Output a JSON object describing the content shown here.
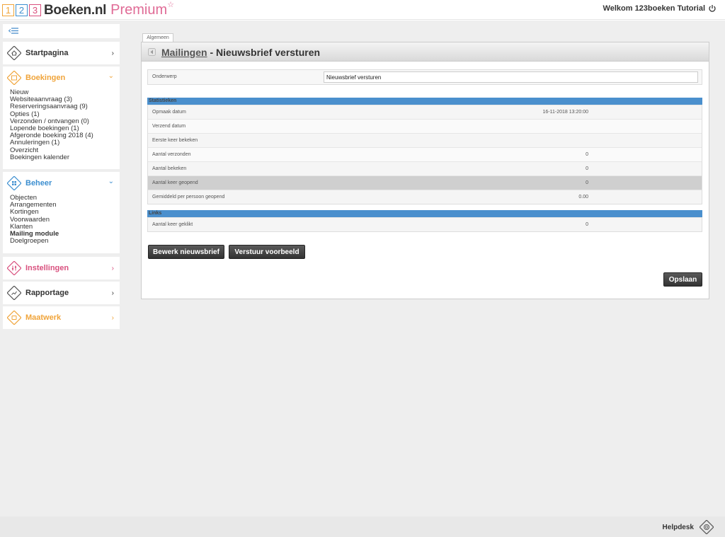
{
  "header": {
    "logo_digits": [
      "1",
      "2",
      "3"
    ],
    "logo_text": "Boeken.nl",
    "logo_premium": "Premium",
    "logo_star": "☆",
    "welcome": "Welkom 123boeken Tutorial"
  },
  "sidebar": {
    "startpagina": {
      "label": "Startpagina",
      "chevron": "›"
    },
    "boekingen": {
      "label": "Boekingen",
      "chevron": "⌄",
      "color": "#f0a43a",
      "items": [
        "Nieuw",
        "Websiteaanvraag (3)",
        "Reserveringsaanvraag (9)",
        "Opties (1)",
        "Verzonden / ontvangen (0)",
        "Lopende boekingen (1)",
        "Afgeronde boeking 2018 (4)",
        "Annuleringen (1)",
        "Overzicht",
        "Boekingen kalender"
      ]
    },
    "beheer": {
      "label": "Beheer",
      "chevron": "⌄",
      "color": "#3d8fd0",
      "items": [
        "Objecten",
        "Arrangementen",
        "Kortingen",
        "Voorwaarden",
        "Klanten",
        "Mailing module",
        "Doelgroepen"
      ],
      "active": "Mailing module"
    },
    "instellingen": {
      "label": "Instellingen",
      "chevron": "›",
      "color": "#d9507e"
    },
    "rapportage": {
      "label": "Rapportage",
      "chevron": "›"
    },
    "maatwerk": {
      "label": "Maatwerk",
      "chevron": "›",
      "color": "#f0a43a"
    }
  },
  "main": {
    "tab": "Algemeen",
    "title_link": "Mailingen",
    "title_rest": " - Nieuwsbrief versturen",
    "onderwerp_label": "Onderwerp",
    "onderwerp_value": "Nieuwsbrief versturen",
    "statistieken": {
      "heading": "Statistieken",
      "rows": [
        {
          "label": "Opmaak datum",
          "value": "16-11-2018 13:20:00"
        },
        {
          "label": "Verzend datum",
          "value": ""
        },
        {
          "label": "Eerste keer bekeken",
          "value": ""
        },
        {
          "label": "Aantal verzonden",
          "value": "0"
        },
        {
          "label": "Aantal bekeken",
          "value": "0"
        },
        {
          "label": "Aantal keer geopend",
          "value": "0"
        },
        {
          "label": "Gemiddeld per persoon geopend",
          "value": "0.00"
        }
      ]
    },
    "links": {
      "heading": "Links",
      "rows": [
        {
          "label": "Aantal keer geklikt",
          "value": "0"
        }
      ]
    },
    "buttons": {
      "bewerk": "Bewerk nieuwsbrief",
      "verstuur": "Verstuur voorbeeld",
      "opslaan": "Opslaan"
    }
  },
  "footer": {
    "helpdesk": "Helpdesk"
  }
}
